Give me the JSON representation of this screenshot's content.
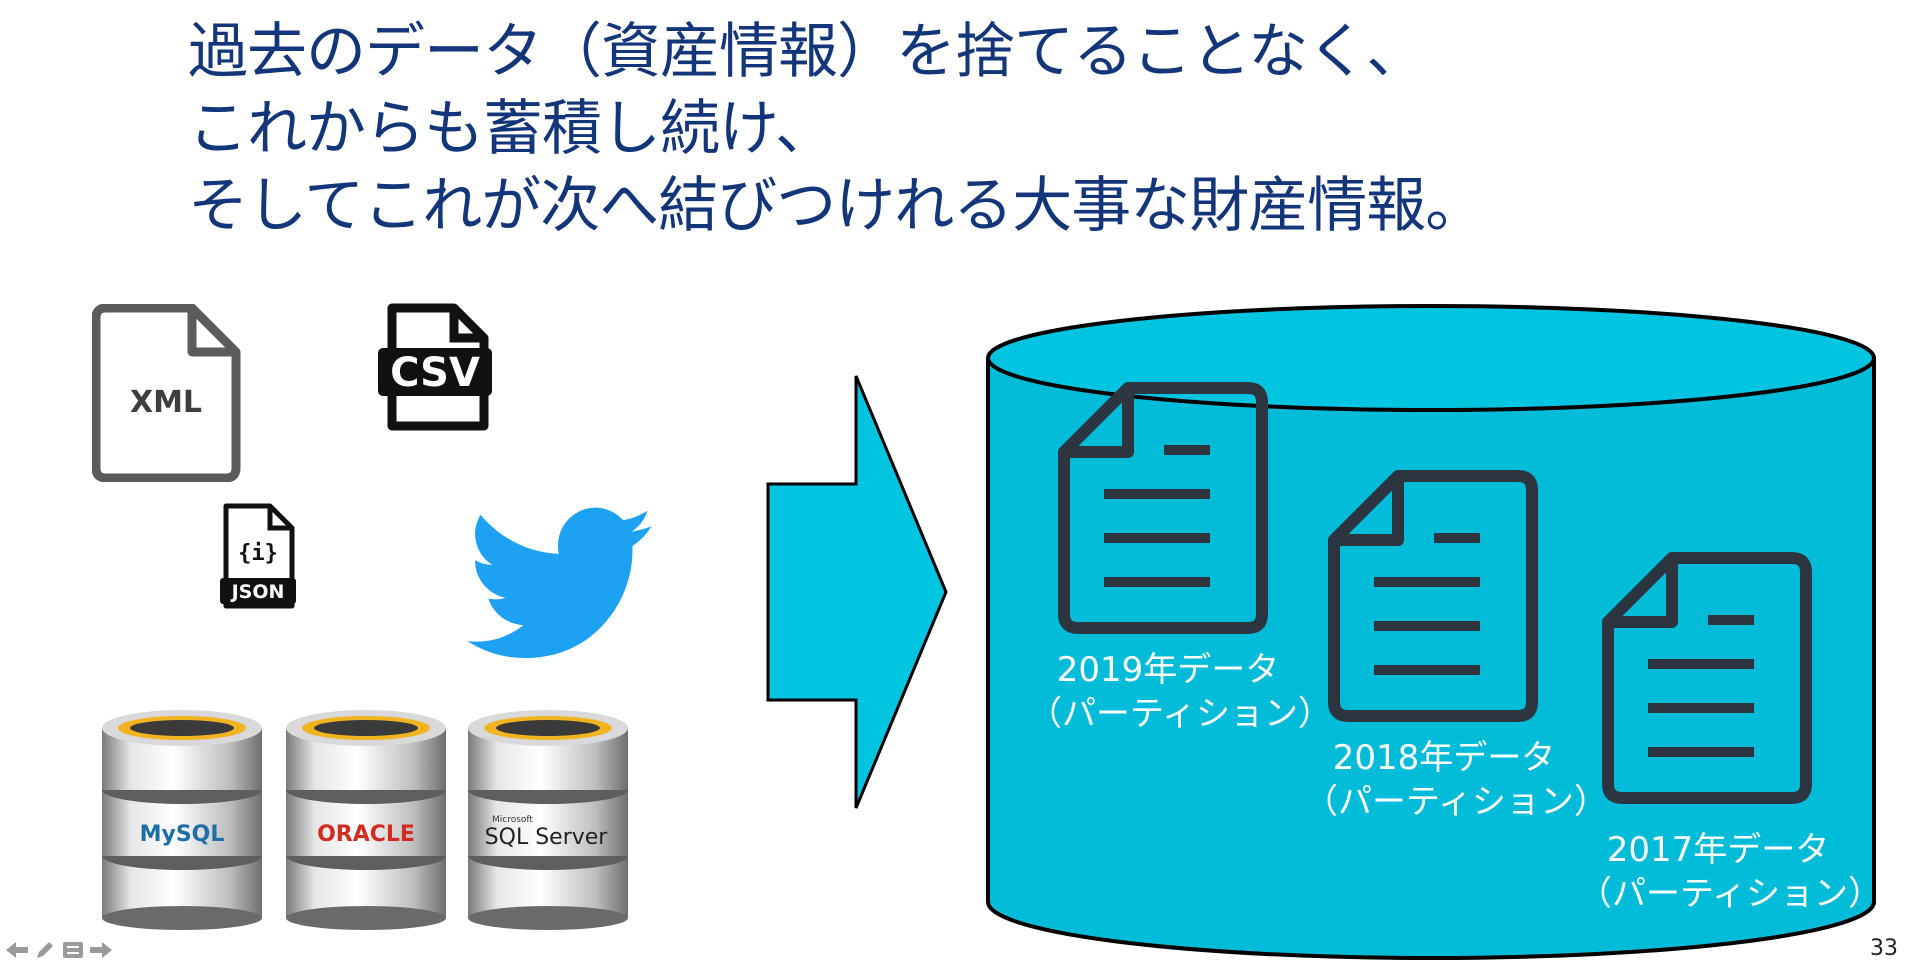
{
  "title": {
    "line1": "過去のデータ（資産情報）を捨てることなく、",
    "line2": "これからも蓄積し続け、",
    "line3": "そしてこれが次へ結びつけれる大事な財産情報。"
  },
  "sources": {
    "xml_label": "XML",
    "csv_label": "CSV",
    "json_label": "JSON",
    "json_symbol": "{i}",
    "databases": [
      "MySQL",
      "ORACLE",
      "SQL Server"
    ],
    "sqlserver_brand": "Microsoft",
    "colors": {
      "twitter": "#1da1f2",
      "accent": "#00c4e0",
      "outline": "#2d3540"
    }
  },
  "partitions": [
    {
      "year": "2019年データ",
      "sub": "（パーティション）"
    },
    {
      "year": "2018年データ",
      "sub": "（パーティション）"
    },
    {
      "year": "2017年データ",
      "sub": "（パーティション）"
    }
  ],
  "footer": {
    "page_number": "33"
  }
}
